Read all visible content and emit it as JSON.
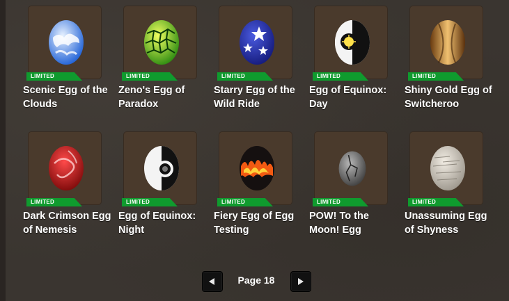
{
  "items": [
    {
      "name": "Scenic Egg of the Clouds",
      "badge": "LIMITED",
      "icon": "cloud-egg-icon"
    },
    {
      "name": "Zeno's Egg of Paradox",
      "badge": "LIMITED",
      "icon": "green-cell-egg-icon"
    },
    {
      "name": "Starry Egg of the Wild Ride",
      "badge": "LIMITED",
      "icon": "star-egg-icon"
    },
    {
      "name": "Egg of Equinox: Day",
      "badge": "LIMITED",
      "icon": "equinox-day-egg-icon"
    },
    {
      "name": "Shiny Gold Egg of Switcheroo",
      "badge": "LIMITED",
      "icon": "gold-egg-icon"
    },
    {
      "name": "Dark Crimson Egg of Nemesis",
      "badge": "LIMITED",
      "icon": "crimson-egg-icon"
    },
    {
      "name": "Egg of Equinox: Night",
      "badge": "LIMITED",
      "icon": "equinox-night-egg-icon"
    },
    {
      "name": "Fiery Egg of Egg Testing",
      "badge": "LIMITED",
      "icon": "fiery-egg-icon"
    },
    {
      "name": "POW! To the Moon! Egg",
      "badge": "LIMITED",
      "icon": "moon-rock-egg-icon"
    },
    {
      "name": "Unassuming Egg of Shyness",
      "badge": "LIMITED",
      "icon": "stone-egg-icon"
    }
  ],
  "pagination": {
    "label": "Page 18",
    "prev_icon": "left-arrow-icon",
    "next_icon": "right-arrow-icon"
  },
  "colors": {
    "tile": "#4a3a2c",
    "badge": "#0f9b2e",
    "background": "#3a3530"
  }
}
